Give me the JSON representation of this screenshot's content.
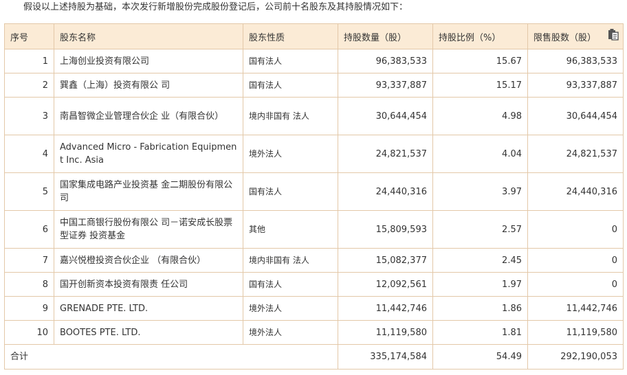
{
  "intro": "假设以上述持股为基础，本次发行新增股份完成股份登记后，公司前十名股东及其持股情况如下：",
  "headers": {
    "idx": "序号",
    "name": "股东名称",
    "nature": "股东性质",
    "shares": "持股数量（股）",
    "ratio": "持股比例（%）",
    "restricted": "限售股数（股）"
  },
  "copy_icon": "clipboard-icon",
  "rows": [
    {
      "idx": "1",
      "name": "上海创业投资有限公司",
      "nature": "国有法人",
      "shares": "96,383,533",
      "ratio": "15.67",
      "restricted": "96,383,533"
    },
    {
      "idx": "2",
      "name": "巽鑫（上海）投资有限公 司",
      "nature": "国有法人",
      "shares": "93,337,887",
      "ratio": "15.17",
      "restricted": "93,337,887"
    },
    {
      "idx": "3",
      "name": "南昌智微企业管理合伙企 业（有限合伙）",
      "nature": "境内非国有 法人",
      "shares": "30,644,454",
      "ratio": "4.98",
      "restricted": "30,644,454"
    },
    {
      "idx": "4",
      "name": "Advanced Micro - Fabrication Equipment Inc. Asia",
      "nature": "境外法人",
      "shares": "24,821,537",
      "ratio": "4.04",
      "restricted": "24,821,537"
    },
    {
      "idx": "5",
      "name": "国家集成电路产业投资基 金二期股份有限公司",
      "nature": "国有法人",
      "shares": "24,440,316",
      "ratio": "3.97",
      "restricted": "24,440,316"
    },
    {
      "idx": "6",
      "name": "中国工商银行股份有限公 司－诺安成长股票型证券 投资基金",
      "nature": "其他",
      "shares": "15,809,593",
      "ratio": "2.57",
      "restricted": "0"
    },
    {
      "idx": "7",
      "name": "嘉兴悦橙投资合伙企业 （有限合伙）",
      "nature": "境内非国有 法人",
      "shares": "15,082,377",
      "ratio": "2.45",
      "restricted": "0"
    },
    {
      "idx": "8",
      "name": "国开创新资本投资有限责 任公司",
      "nature": "国有法人",
      "shares": "12,092,561",
      "ratio": "1.97",
      "restricted": "0"
    },
    {
      "idx": "9",
      "name": "GRENADE PTE. LTD.",
      "nature": "境外法人",
      "shares": "11,442,746",
      "ratio": "1.86",
      "restricted": "11,442,746"
    },
    {
      "idx": "10",
      "name": "BOOTES PTE. LTD.",
      "nature": "境外法人",
      "shares": "11,119,580",
      "ratio": "1.81",
      "restricted": "11,119,580"
    }
  ],
  "total": {
    "label": "合计",
    "shares": "335,174,584",
    "ratio": "54.49",
    "restricted": "292,190,053"
  }
}
